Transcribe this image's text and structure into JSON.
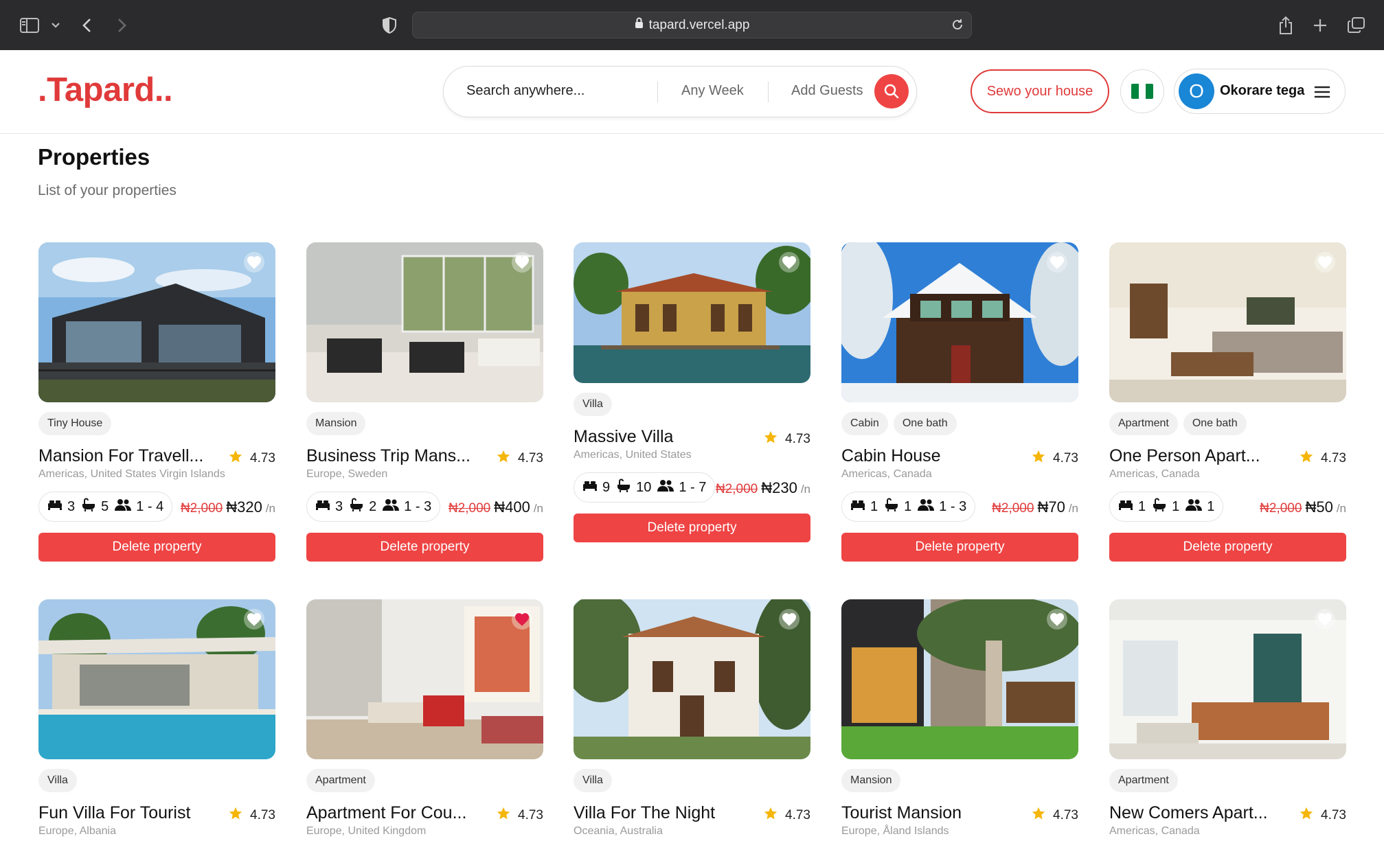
{
  "browser": {
    "url": "tapard.vercel.app"
  },
  "header": {
    "logo": ".Tapard..",
    "search_placeholder": "Search anywhere...",
    "any_week": "Any Week",
    "add_guests": "Add Guests",
    "host_button": "Sewo your house",
    "flag_colors": [
      "#00843d",
      "#ffffff",
      "#00843d"
    ],
    "user_initial": "O",
    "user_name": "Okorare tega"
  },
  "page": {
    "title": "Properties",
    "subtitle": "List of your properties"
  },
  "delete_label": "Delete property",
  "accent": "#ef4444",
  "cards": [
    {
      "tags": [
        "Tiny House"
      ],
      "title": "Mansion For Travell...",
      "rating": "4.73",
      "location": "Americas, United States Virgin Islands",
      "beds": "3",
      "baths": "5",
      "guests": "1 - 4",
      "old_price": "₦2,000",
      "price": "₦320",
      "per": "/n",
      "favorite": false
    },
    {
      "tags": [
        "Mansion"
      ],
      "title": "Business Trip Mans...",
      "rating": "4.73",
      "location": "Europe, Sweden",
      "beds": "3",
      "baths": "2",
      "guests": "1 - 3",
      "old_price": "₦2,000",
      "price": "₦400",
      "per": "/n",
      "favorite": false
    },
    {
      "tags": [
        "Villa"
      ],
      "title": "Massive Villa",
      "rating": "4.73",
      "location": "Americas, United States",
      "beds": "9",
      "baths": "10",
      "guests": "1 - 7",
      "old_price": "₦2,000",
      "price": "₦230",
      "per": "/n",
      "favorite": false
    },
    {
      "tags": [
        "Cabin",
        "One bath"
      ],
      "title": "Cabin House",
      "rating": "4.73",
      "location": "Americas, Canada",
      "beds": "1",
      "baths": "1",
      "guests": "1 - 3",
      "old_price": "₦2,000",
      "price": "₦70",
      "per": "/n",
      "favorite": false
    },
    {
      "tags": [
        "Apartment",
        "One bath"
      ],
      "title": "One Person Apart...",
      "rating": "4.73",
      "location": "Americas, Canada",
      "beds": "1",
      "baths": "1",
      "guests": "1",
      "old_price": "₦2,000",
      "price": "₦50",
      "per": "/n",
      "favorite": false
    },
    {
      "tags": [
        "Villa"
      ],
      "title": "Fun Villa For Tourist",
      "rating": "4.73",
      "location": "Europe, Albania",
      "favorite": false
    },
    {
      "tags": [
        "Apartment"
      ],
      "title": "Apartment For Cou...",
      "rating": "4.73",
      "location": "Europe, United Kingdom",
      "favorite": true
    },
    {
      "tags": [
        "Villa"
      ],
      "title": "Villa For The Night",
      "rating": "4.73",
      "location": "Oceania, Australia",
      "favorite": false
    },
    {
      "tags": [
        "Mansion"
      ],
      "title": "Tourist Mansion",
      "rating": "4.73",
      "location": "Europe, Åland Islands",
      "favorite": false
    },
    {
      "tags": [
        "Apartment"
      ],
      "title": "New Comers Apart...",
      "rating": "4.73",
      "location": "Americas, Canada",
      "favorite": false
    }
  ]
}
